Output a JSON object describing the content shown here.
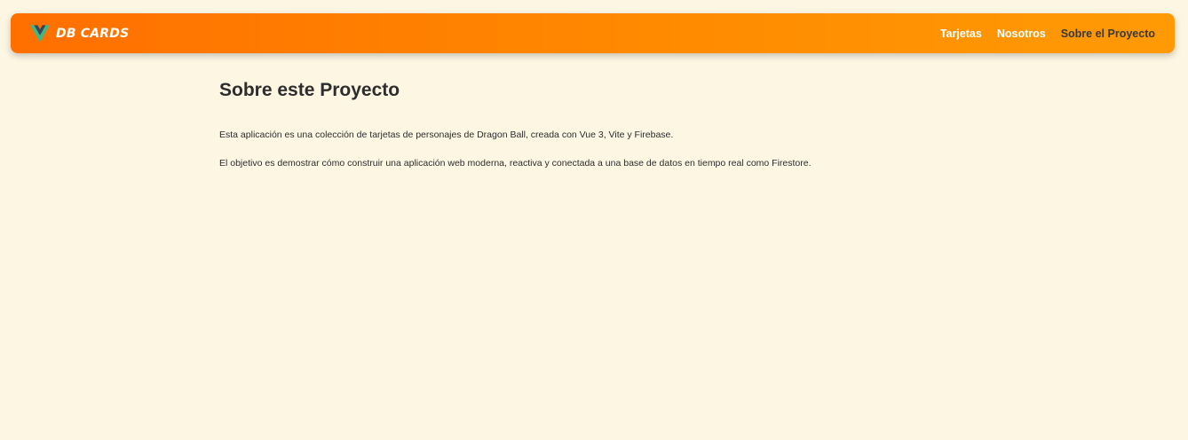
{
  "navbar": {
    "brand_text": "DB CARDS",
    "brand_icon": "vue-logo-icon",
    "links": [
      {
        "label": "Tarjetas",
        "active": false
      },
      {
        "label": "Nosotros",
        "active": false
      },
      {
        "label": "Sobre el Proyecto",
        "active": true
      }
    ],
    "gradient_start": "#ff6f00",
    "gradient_end": "#ff9a05"
  },
  "main": {
    "title": "Sobre este Proyecto",
    "paragraphs": [
      "Esta aplicación es una colección de tarjetas de personajes de Dragon Ball, creada con Vue 3, Vite y Firebase.",
      "El objetivo es demostrar cómo construir una aplicación web moderna, reactiva y conectada a una base de datos en tiempo real como Firestore."
    ]
  },
  "colors": {
    "page_background": "#fdf6e3",
    "active_link": "#3a3a3a",
    "vue_green": "#41b883",
    "vue_dark": "#35495e"
  }
}
